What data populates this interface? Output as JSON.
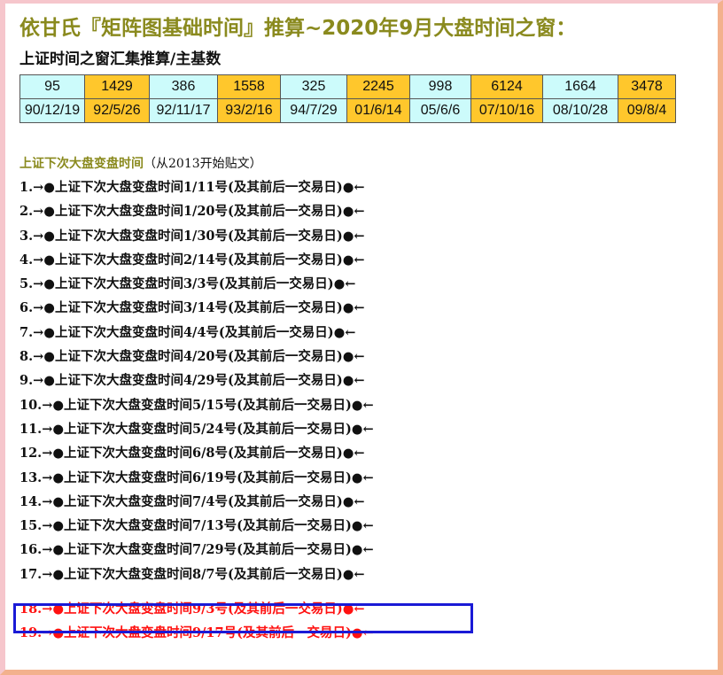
{
  "title": "依甘氏『矩阵图基础时间』推算~2020年9月大盘时间之窗：",
  "subtitle": "上证时间之窗汇集推算/主基数",
  "pivot_table": {
    "values": [
      "95",
      "1429",
      "386",
      "1558",
      "325",
      "2245",
      "998",
      "6124",
      "1664",
      "3478"
    ],
    "dates": [
      "90/12/19",
      "92/5/26",
      "92/11/17",
      "93/2/16",
      "94/7/29",
      "01/6/14",
      "05/6/6",
      "07/10/16",
      "08/10/28",
      "09/8/4"
    ],
    "column_fills": [
      "cyan",
      "orange",
      "cyan",
      "orange",
      "cyan",
      "orange",
      "cyan",
      "orange",
      "cyan",
      "orange"
    ],
    "colors": {
      "cyan": "#ccfbfb",
      "orange": "#ffc72c"
    }
  },
  "section": {
    "title": "上证下次大盘变盘时间",
    "note": "（从2013开始贴文）"
  },
  "items": [
    "1.→●上证下次大盘变盘时间1/11号(及其前后一交易日)●←",
    "2.→●上证下次大盘变盘时间1/20号(及其前后一交易日)●←",
    "3.→●上证下次大盘变盘时间1/30号(及其前后一交易日)●←",
    "4.→●上证下次大盘变盘时间2/14号(及其前后一交易日)●←",
    "5.→●上证下次大盘变盘时间3/3号(及其前后一交易日)●←",
    "6.→●上证下次大盘变盘时间3/14号(及其前后一交易日)●←",
    "7.→●上证下次大盘变盘时间4/4号(及其前后一交易日)●←",
    "8.→●上证下次大盘变盘时间4/20号(及其前后一交易日)●←",
    "9.→●上证下次大盘变盘时间4/29号(及其前后一交易日)●←",
    "10.→●上证下次大盘变盘时间5/15号(及其前后一交易日)●←",
    "11.→●上证下次大盘变盘时间5/24号(及其前后一交易日)●←",
    "12.→●上证下次大盘变盘时间6/8号(及其前后一交易日)●←",
    "13.→●上证下次大盘变盘时间6/19号(及其前后一交易日)●←",
    "14.→●上证下次大盘变盘时间7/4号(及其前后一交易日)●←",
    "15.→●上证下次大盘变盘时间7/13号(及其前后一交易日)●←",
    "16.→●上证下次大盘变盘时间7/29号(及其前后一交易日)●←",
    "17.→●上证下次大盘变盘时间8/7号(及其前后一交易日)●←",
    "18.→●上证下次大盘变盘时间9/3号(及其前后一交易日)●←",
    "19.→●上证下次大盘变盘时间9/17号(及其前后一交易日)●←"
  ],
  "highlight_color": "#ff1111",
  "box_color": "#1a1ad6"
}
